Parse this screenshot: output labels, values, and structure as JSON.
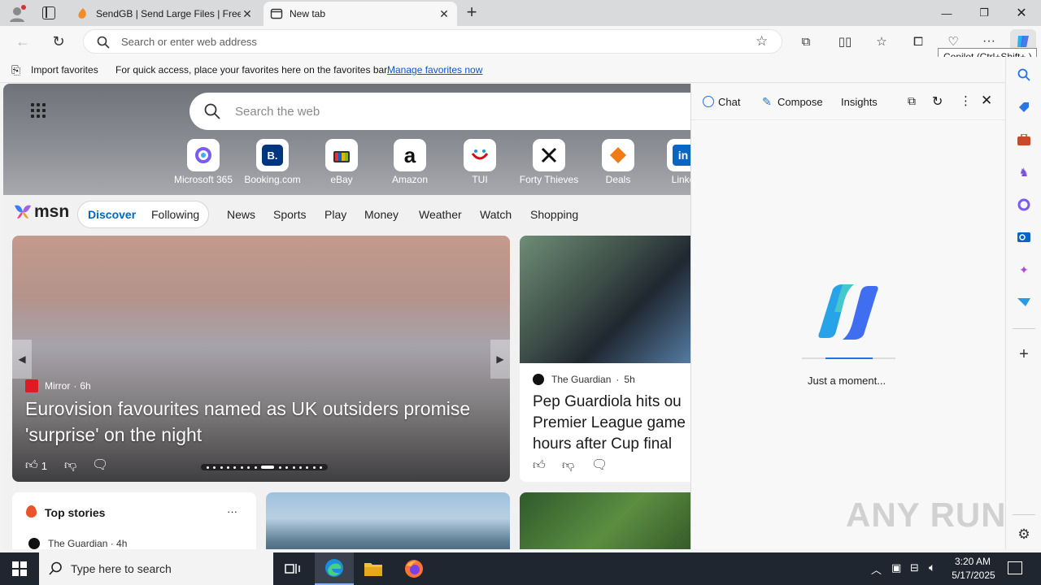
{
  "tabs": [
    {
      "title": "SendGB | Send Large Files | Free f",
      "active": false
    },
    {
      "title": "New tab",
      "active": true
    }
  ],
  "address_bar": {
    "placeholder": "Search or enter web address"
  },
  "favorites_bar": {
    "import_label": "Import favorites",
    "hint": "For quick access, place your favorites here on the favorites bar.",
    "manage_link": "Manage favorites now"
  },
  "tooltip": "Copilot (Ctrl+Shift+.)",
  "newtab": {
    "search_placeholder": "Search the web",
    "quick_links": [
      {
        "label": "Microsoft 365",
        "icon": "microsoft-365-icon"
      },
      {
        "label": "Booking.com",
        "icon": "booking-icon",
        "glyph": "B."
      },
      {
        "label": "eBay",
        "icon": "ebay-icon"
      },
      {
        "label": "Amazon",
        "icon": "amazon-icon",
        "glyph": "a"
      },
      {
        "label": "TUI",
        "icon": "tui-icon"
      },
      {
        "label": "Forty Thieves",
        "icon": "forty-thieves-icon"
      },
      {
        "label": "Deals",
        "icon": "deals-icon"
      },
      {
        "label": "Linke",
        "icon": "linkedin-icon",
        "glyph": "in"
      }
    ]
  },
  "msn": {
    "logo": "msn",
    "toggle": [
      "Discover",
      "Following"
    ],
    "nav": [
      "News",
      "Sports",
      "Play",
      "Money",
      "Weather",
      "Watch",
      "Shopping"
    ]
  },
  "main_story": {
    "source": "Mirror",
    "age": "6h",
    "headline": "Eurovision favourites named as UK outsiders promise 'surprise' on the night",
    "likes": "1"
  },
  "side_story": {
    "source": "The Guardian",
    "age": "5h",
    "headline_lines": [
      "Pep Guardiola hits ou",
      "Premier League game",
      "hours after Cup final"
    ]
  },
  "top_stories": {
    "title": "Top stories",
    "more": "···",
    "first_source": "The Guardian · 4h"
  },
  "copilot": {
    "tabs": [
      "Chat",
      "Compose",
      "Insights"
    ],
    "status": "Just a moment..."
  },
  "taskbar": {
    "search_placeholder": "Type here to search",
    "time": "3:20 AM",
    "date": "5/17/2025"
  },
  "watermark": "ANY RUN",
  "colors": {
    "accent": "#0067c0",
    "msn_active": "#0067c0",
    "copilot_blue": "#2870ea"
  }
}
